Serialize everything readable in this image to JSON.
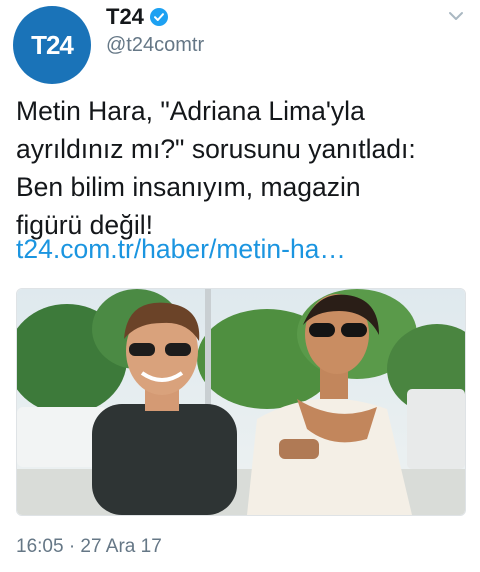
{
  "account": {
    "avatar_text": "T24",
    "display_name": "T24",
    "handle": "@t24comtr",
    "avatar_color": "#1a73b8",
    "verified_color": "#1da1f2"
  },
  "tweet": {
    "lines": [
      "Metin Hara, \"Adriana Lima'yla",
      "ayrıldınız mı?\" sorusunu yanıtladı:",
      "Ben bilim insanıyım, magazin",
      "figürü değil!"
    ],
    "link": "t24.com.tr/haber/metin-ha…",
    "link_color": "#1b95e0"
  },
  "media": {
    "icon": "photo-icon"
  },
  "meta": {
    "timestamp": "16:05 · 27 Ara 17"
  },
  "icons": [
    "verified-badge-icon",
    "chevron-down-icon"
  ]
}
